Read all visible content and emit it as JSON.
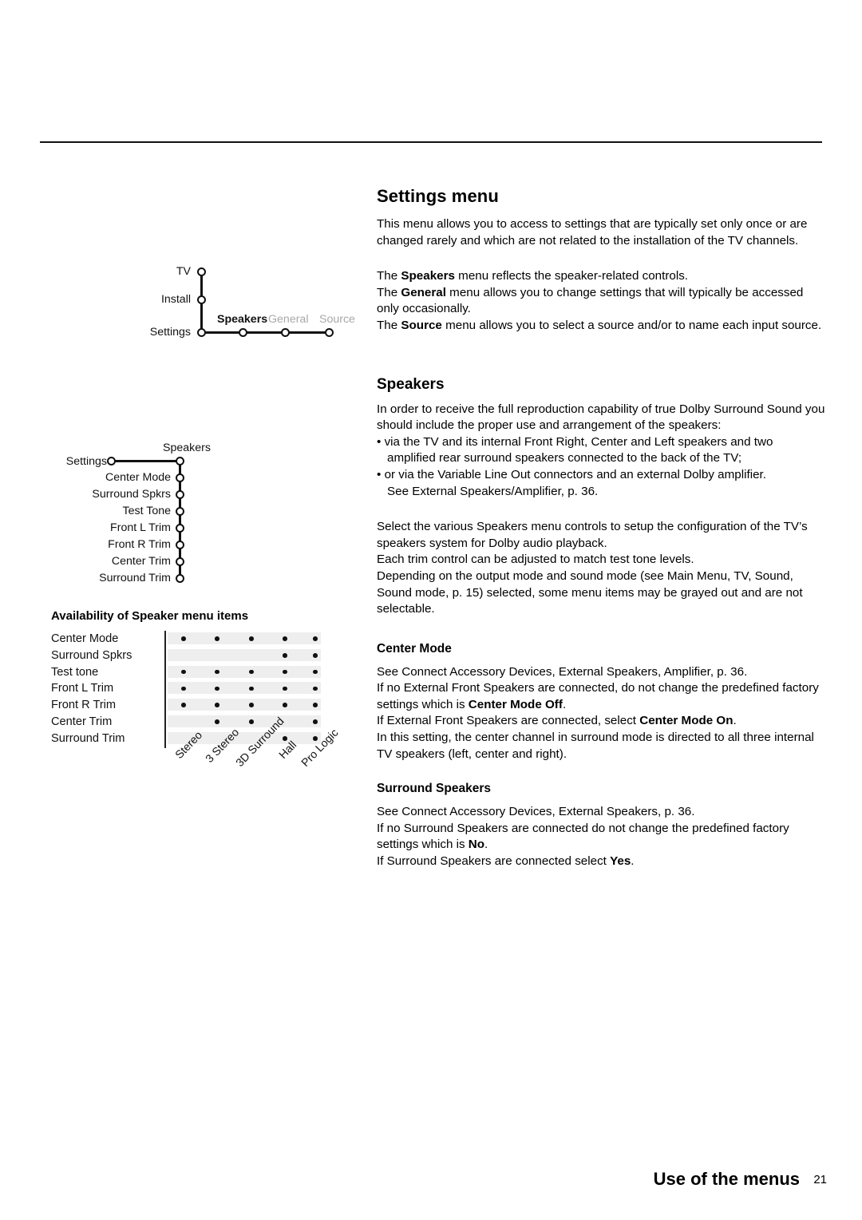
{
  "page": {
    "footer_title": "Use of the menus",
    "page_number": "21"
  },
  "diagram_settings_tree": {
    "nodes": [
      {
        "label": "TV"
      },
      {
        "label": "Install"
      },
      {
        "label": "Settings"
      }
    ],
    "submenu": [
      {
        "label": "Speakers",
        "state": "active"
      },
      {
        "label": "General",
        "state": "grayed"
      },
      {
        "label": "Source",
        "state": "grayed"
      }
    ]
  },
  "diagram_speakers_tree": {
    "root_left": "Settings",
    "root_right": "Speakers",
    "items": [
      "Center Mode",
      "Surround Spkrs",
      "Test Tone",
      "Front L Trim",
      "Front R Trim",
      "Center Trim",
      "Surround Trim"
    ]
  },
  "availability_table": {
    "title": "Availability of Speaker menu items",
    "columns": [
      "Stereo",
      "3 Stereo",
      "3D Surround",
      "Hall",
      "Pro Logic"
    ],
    "rows": [
      {
        "label": "Center Mode",
        "cells": [
          true,
          true,
          true,
          true,
          true
        ]
      },
      {
        "label": "Surround Spkrs",
        "cells": [
          false,
          false,
          false,
          true,
          true
        ]
      },
      {
        "label": "Test tone",
        "cells": [
          true,
          true,
          true,
          true,
          true
        ]
      },
      {
        "label": "Front L Trim",
        "cells": [
          true,
          true,
          true,
          true,
          true
        ]
      },
      {
        "label": "Front R Trim",
        "cells": [
          true,
          true,
          true,
          true,
          true
        ]
      },
      {
        "label": "Center Trim",
        "cells": [
          false,
          true,
          true,
          false,
          true
        ]
      },
      {
        "label": "Surround  Trim",
        "cells": [
          false,
          false,
          false,
          true,
          true
        ]
      }
    ]
  },
  "content": {
    "settings_menu": {
      "heading": "Settings menu",
      "paragraph1": "This menu allows you to access to settings that are typically set only once or are changed rarely and which are not related to the installation of the TV channels.",
      "line_speakers_pre": "The ",
      "line_speakers_bold": "Speakers",
      "line_speakers_post": " menu reflects the speaker-related controls.",
      "line_general_pre": "The ",
      "line_general_bold": "General",
      "line_general_post": " menu allows you to change settings that will typically be accessed only occasionally.",
      "line_source_pre": "The ",
      "line_source_bold": "Source",
      "line_source_post": " menu allows you to select a source and/or to name each input source."
    },
    "speakers": {
      "heading": "Speakers",
      "paragraph1": "In order to receive the full reproduction capability of true Dolby Surround Sound you should include the proper use and arrangement of the speakers:",
      "bullet1_marker": "•",
      "bullet1": "via the TV and its internal Front Right, Center and Left speakers and two",
      "bullet1_cont": "amplified rear surround speakers connected to the back of the TV;",
      "bullet2_marker": "•",
      "bullet2": "or via the Variable Line Out connectors and an external Dolby amplifier.",
      "bullet2_cont": "See External Speakers/Amplifier, p. 36.",
      "paragraph2": "Select the various Speakers menu controls to setup the configuration of the TV’s speakers system for Dolby audio playback.",
      "paragraph3": "Each trim control can be adjusted to match test tone levels.",
      "paragraph4": "Depending on the output mode and sound mode (see Main Menu, TV, Sound, Sound mode, p. 15) selected, some menu items may be grayed out and are not selectable."
    },
    "center_mode": {
      "heading": "Center Mode",
      "line1": "See Connect Accessory Devices, External Speakers, Amplifier, p. 36.",
      "line2_pre": "If no External Front Speakers are connected, do not change the predefined factory settings which is ",
      "line2_bold": "Center Mode Off",
      "line2_post": ".",
      "line3_pre": "If External Front Speakers are connected, select ",
      "line3_bold": "Center Mode On",
      "line3_post": ".",
      "line4": "In this setting, the center channel in surround mode is directed to all three internal TV speakers (left, center and right)."
    },
    "surround_speakers": {
      "heading": "Surround Speakers",
      "line1": "See Connect Accessory Devices, External Speakers, p. 36.",
      "line2_pre": "If no Surround Speakers are connected do not change the predefined factory settings which is ",
      "line2_bold": "No",
      "line2_post": ".",
      "line3_pre": "If Surround Speakers are connected select ",
      "line3_bold": "Yes",
      "line3_post": "."
    }
  }
}
